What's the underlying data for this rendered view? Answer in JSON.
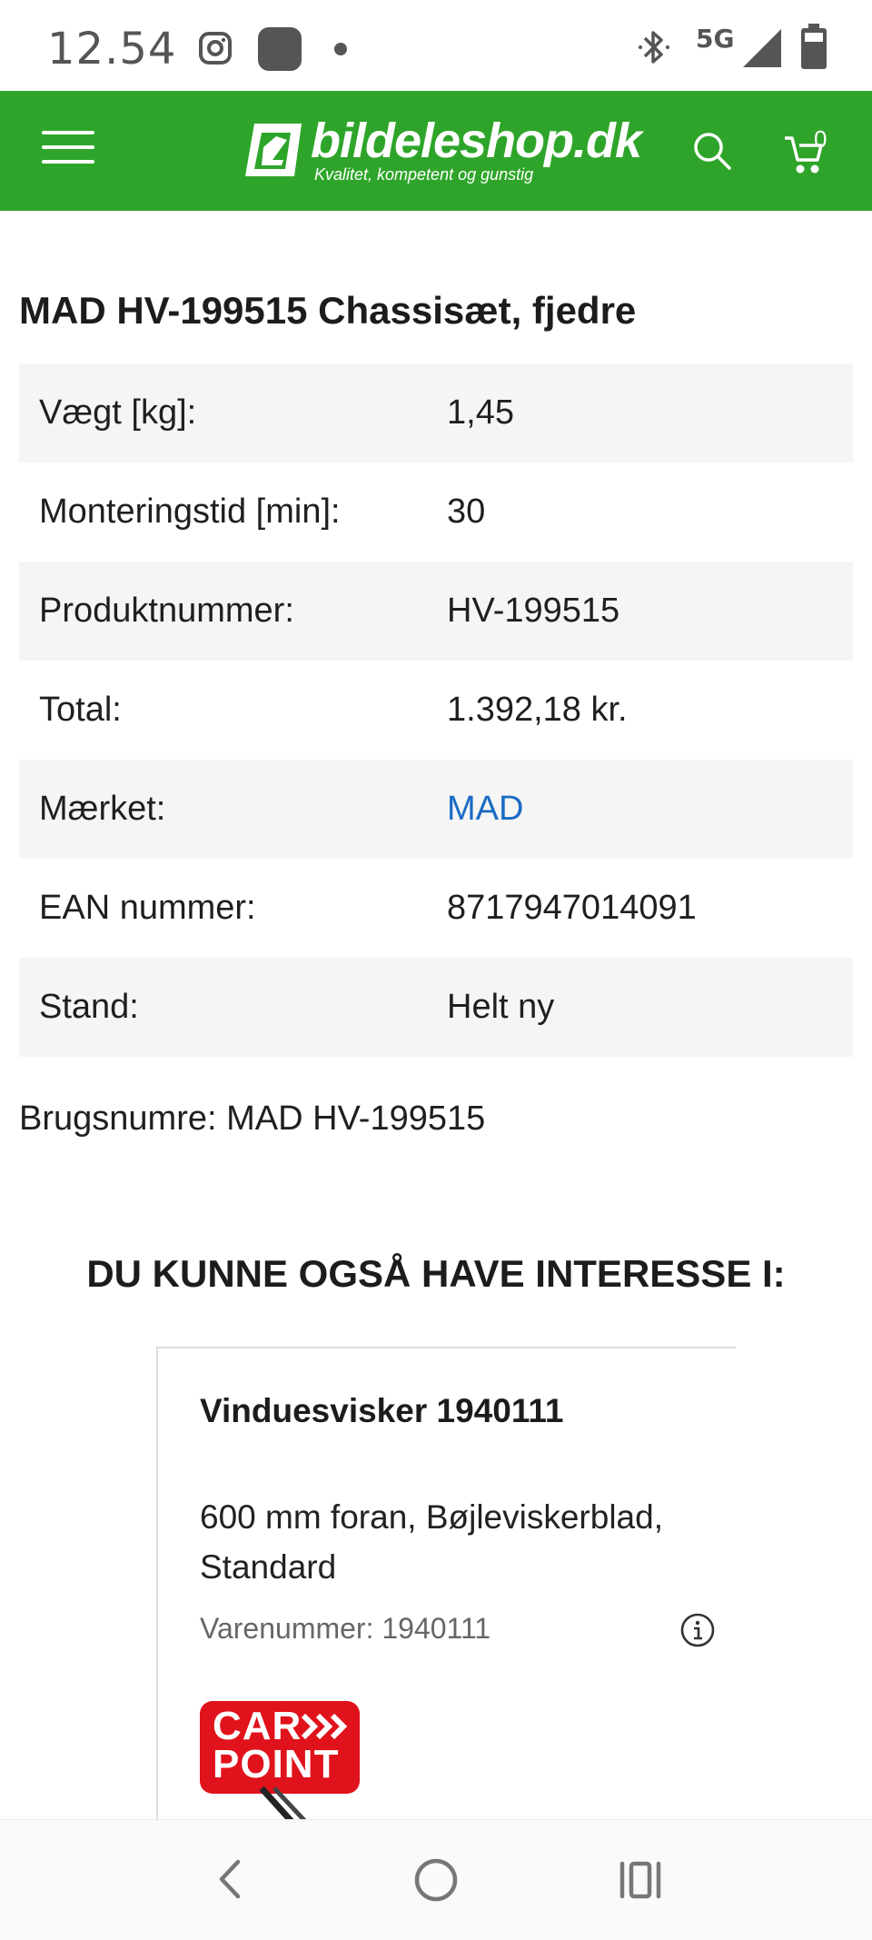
{
  "status_bar": {
    "time": "12.54",
    "network": "5G"
  },
  "header": {
    "logo_name": "bildeleshop.dk",
    "logo_tagline": "Kvalitet, kompetent og gunstig",
    "cart_count": "0",
    "background_color": "#2ea52a"
  },
  "product": {
    "title": "MAD HV-199515 Chassisæt, fjedre",
    "specs": [
      {
        "label": "Vægt [kg]:",
        "value": "1,45"
      },
      {
        "label": "Monteringstid [min]:",
        "value": "30"
      },
      {
        "label": "Produktnummer:",
        "value": "HV-199515"
      },
      {
        "label": "Total:",
        "value": "1.392,18 kr."
      },
      {
        "label": "Mærket:",
        "value": "MAD"
      },
      {
        "label": "EAN nummer:",
        "value": "8717947014091"
      },
      {
        "label": "Stand:",
        "value": "Helt ny"
      }
    ],
    "brugsnumre": "Brugsnumre: MAD HV-199515",
    "link_color": "#1a6bc4"
  },
  "related": {
    "heading": "DU KUNNE OGSÅ HAVE INTERESSE I:",
    "card": {
      "title": "Vinduesvisker 1940111",
      "description": "600 mm foran, Bøjleviskerblad, Standard",
      "sku": "Varenummer: 1940111",
      "brand_logo_line1": "CAR",
      "brand_logo_line2": "POINT"
    }
  },
  "icons": {
    "menu": "hamburger-menu-icon",
    "search": "search-icon",
    "cart": "cart-icon",
    "info": "info-icon",
    "back": "back-icon",
    "home": "home-icon",
    "recent": "recent-apps-icon"
  }
}
